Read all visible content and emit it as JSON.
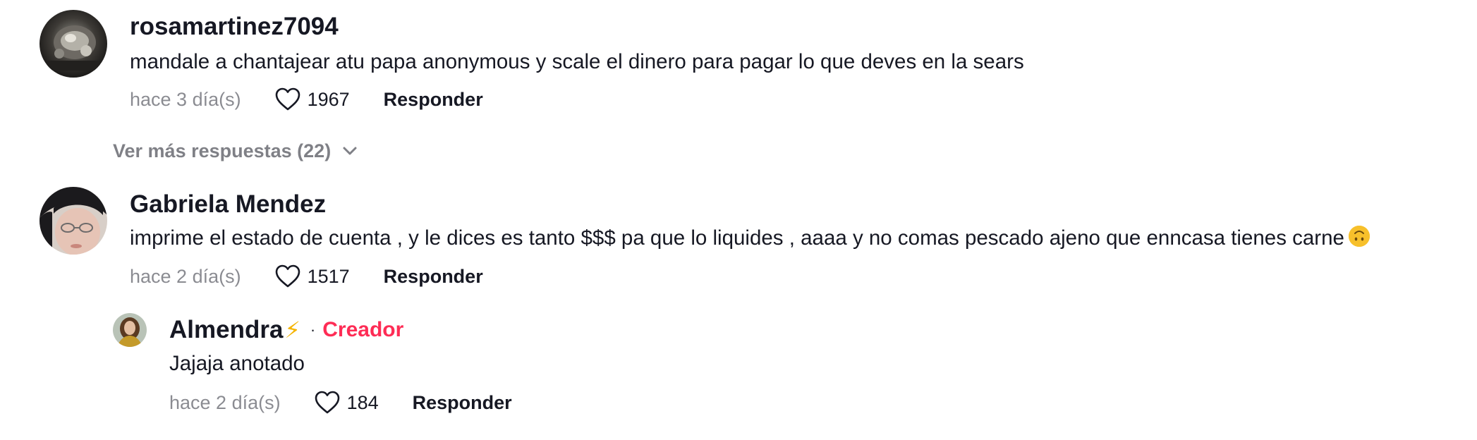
{
  "comments": [
    {
      "username": "rosamartinez7094",
      "text": "mandale a chantajear atu papa anonymous y scale el dinero para pagar lo que deves en la sears",
      "time": "hace 3 día(s)",
      "likes": "1967",
      "reply_label": "Responder"
    },
    {
      "username": "Gabriela Mendez",
      "text": "imprime el estado de cuenta , y le dices es tanto $$$ pa que lo liquides , aaaa y no comas pescado ajeno que enncasa tienes carne",
      "time": "hace 2 día(s)",
      "likes": "1517",
      "reply_label": "Responder"
    }
  ],
  "replies_toggle": {
    "label": "Ver más respuestas (22)"
  },
  "reply": {
    "username": "Almendra",
    "bolt": "⚡",
    "separator": "·",
    "creator_badge": "Creador",
    "text": "Jajaja anotado",
    "time": "hace 2 día(s)",
    "likes": "184",
    "reply_label": "Responder"
  },
  "icons": {
    "like": "heart-outline-icon",
    "expand": "chevron-down-icon",
    "emoji": "upside-down-face-emoji-icon"
  },
  "colors": {
    "text": "#161823",
    "muted": "#8a8b91",
    "creator": "#fe2c55",
    "bolt": "#f5b400"
  }
}
